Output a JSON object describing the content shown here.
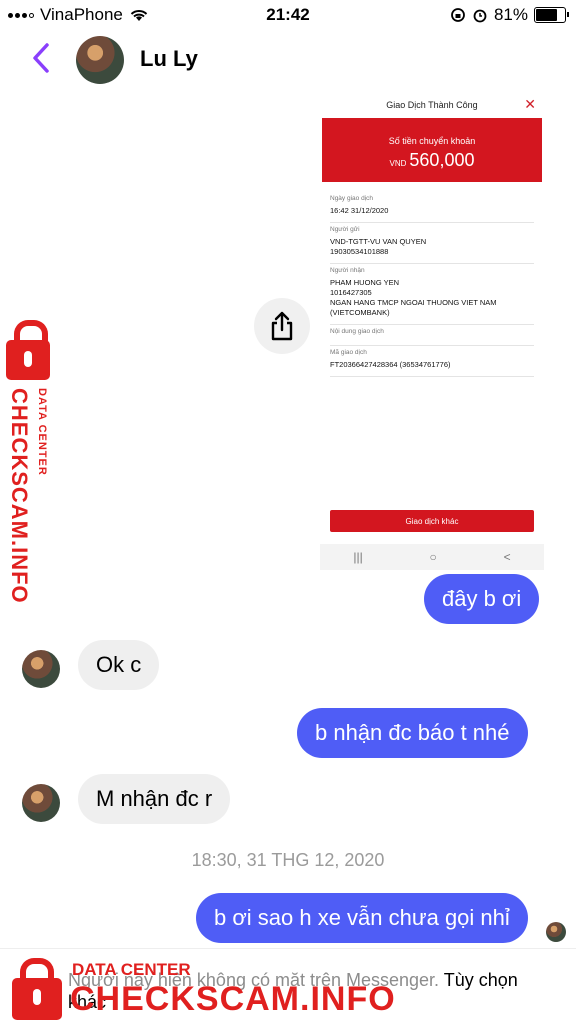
{
  "status_bar": {
    "carrier": "VinaPhone",
    "time": "21:42",
    "battery": "81%",
    "battery_level": 0.81
  },
  "header": {
    "contact_name": "Lu Ly"
  },
  "receipt": {
    "title": "Giao Dịch Thành Công",
    "amount_label": "Số tiền chuyển khoản",
    "currency": "VND",
    "amount": "560,000",
    "rows": [
      {
        "label": "Ngày giao dịch",
        "value": "16:42 31/12/2020"
      },
      {
        "label": "Người gửi",
        "value": "VND-TGTT-VU VAN QUYEN\n19030534101888"
      },
      {
        "label": "Người nhận",
        "value": "PHAM HUONG YEN\n1016427305\nNGAN HANG TMCP NGOAI THUONG VIET NAM\n(VIETCOMBANK)"
      },
      {
        "label": "Nội dung giao dịch",
        "value": ""
      },
      {
        "label": "Mã giao dịch",
        "value": "FT20366427428364 (36534761776)"
      }
    ],
    "button": "Giao dịch khác",
    "nav": [
      "|||",
      "○",
      "<"
    ]
  },
  "messages": [
    {
      "dir": "out",
      "text": "đây b ơi"
    },
    {
      "dir": "in",
      "text": "Ok c"
    },
    {
      "dir": "out",
      "text": "b nhận đc báo t nhé"
    },
    {
      "dir": "in",
      "text": "M nhận đc r"
    },
    {
      "dir": "out",
      "text": "b ơi sao h xe vẫn chưa gọi nhỉ"
    }
  ],
  "timestamp": "18:30, 31 THG 12, 2020",
  "footer": {
    "notice": "Người này hiện không có mặt trên Messenger.",
    "option": "Tùy chọn khác"
  },
  "watermark": {
    "sub": "DATA CENTER",
    "main": "CHECKSCAM.INFO",
    "color": "#e0201f"
  }
}
